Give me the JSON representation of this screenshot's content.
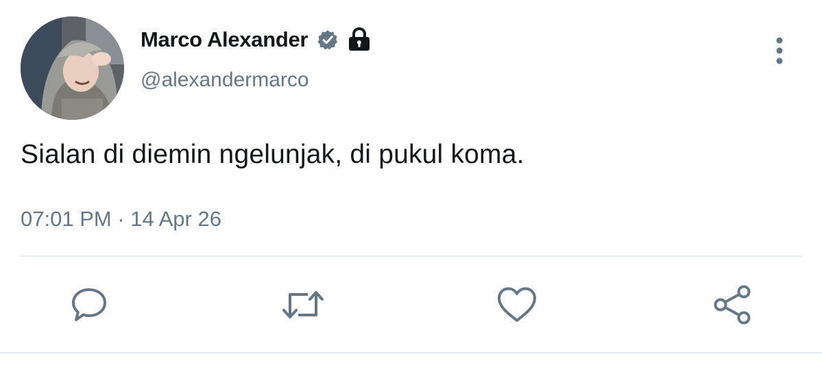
{
  "tweet": {
    "author": {
      "display_name": "Marco Alexander",
      "handle": "@alexandermarco",
      "verified": true,
      "protected": true
    },
    "text": "Sialan di diemin ngelunjak, di pukul koma.",
    "meta": "07:01 PM · 14 Apr 26"
  },
  "actions": [
    "reply-icon",
    "retweet-icon",
    "like-icon",
    "share-icon"
  ],
  "colors": {
    "text": "#14171a",
    "secondary": "#657786",
    "divider": "#e6ecf0",
    "badge": "#657786"
  }
}
